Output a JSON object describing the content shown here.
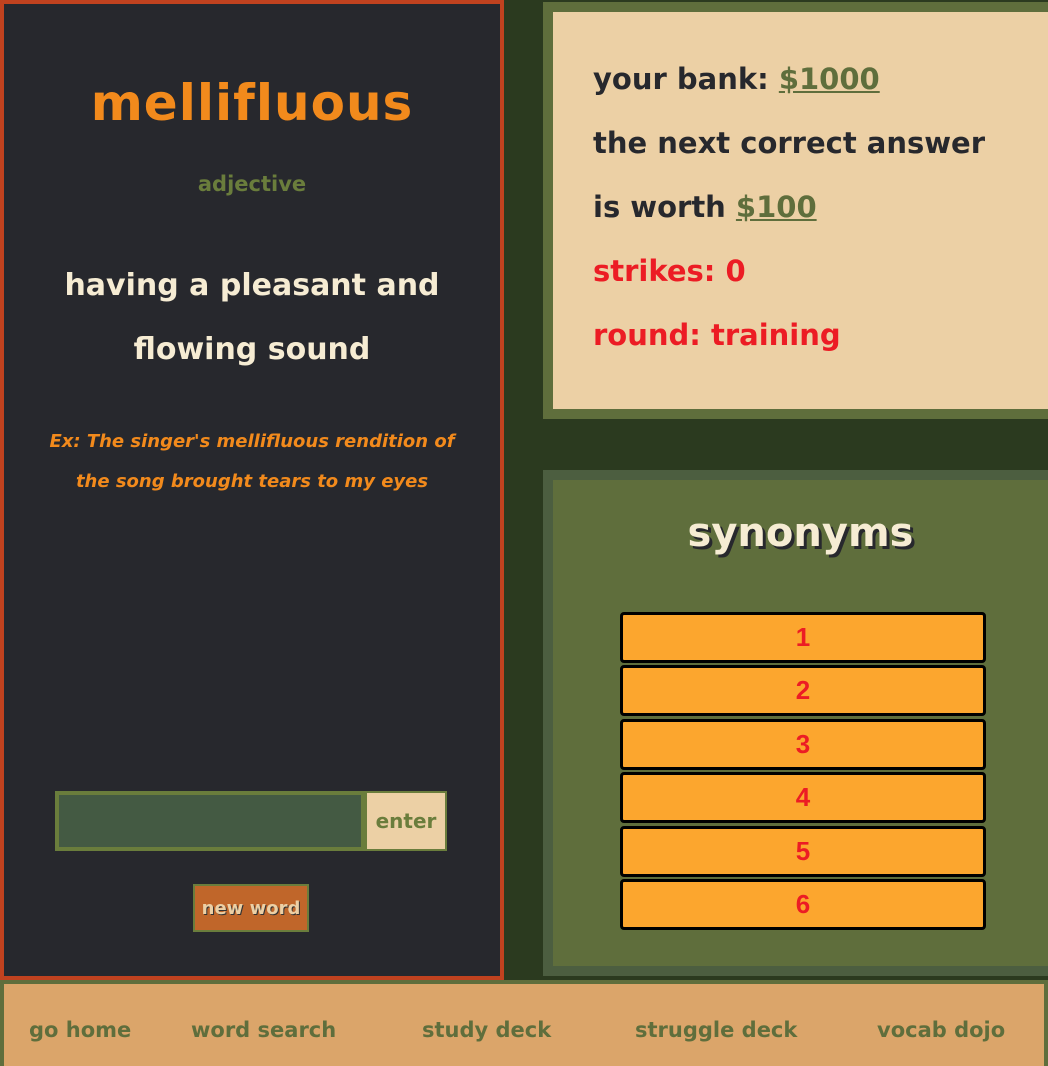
{
  "word_panel": {
    "word": "mellifluous",
    "part_of_speech": "adjective",
    "definition_line1": "having a pleasant and",
    "definition_line2": "flowing sound",
    "example_line1": "Ex: The singer's mellifluous rendition of",
    "example_line2": "the song brought tears to my eyes",
    "input_value": "",
    "enter_label": "enter",
    "new_word_label": "new word"
  },
  "stats": {
    "bank_label": "your bank: ",
    "bank_value": "$1000",
    "next_line1": "the next correct answer",
    "next_line2_prefix": "is worth ",
    "next_value": "$100",
    "strikes": "strikes: 0",
    "round": "round: training"
  },
  "synonyms": {
    "title": "synonyms",
    "items": [
      "1",
      "2",
      "3",
      "4",
      "5",
      "6"
    ]
  },
  "nav": {
    "items": [
      "go home",
      "word search",
      "study deck",
      "struggle deck",
      "vocab dojo"
    ]
  },
  "colors": {
    "background": "#2b3a1f",
    "panel_dark": "#27282d",
    "accent_orange": "#f28a1c",
    "olive": "#5f6e3c",
    "cream": "#ecd0a5",
    "red": "#ec1c24",
    "synonym_slot": "#fca62e"
  }
}
